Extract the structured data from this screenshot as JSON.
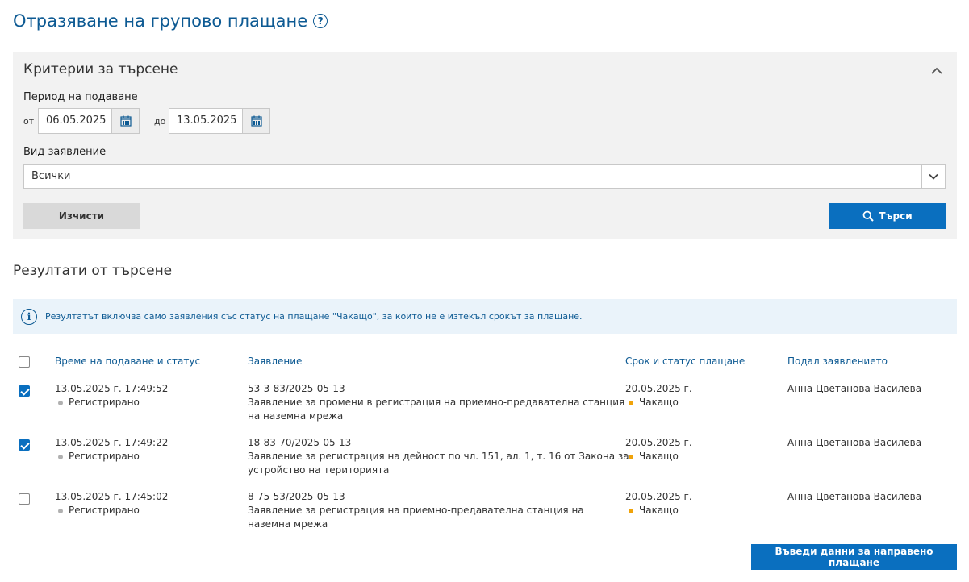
{
  "page": {
    "title": "Отразяване на групово плащане",
    "help_icon": "question-circle-icon"
  },
  "criteria": {
    "title": "Критерии за търсене",
    "period_label": "Период на подаване",
    "from_label": "от",
    "from_value": "06.05.2025",
    "to_label": "до",
    "to_value": "13.05.2025",
    "type_label": "Вид заявление",
    "type_value": "Всички",
    "clear_label": "Изчисти",
    "search_label": "Търси"
  },
  "results": {
    "title": "Резултати от търсене",
    "info_text": "Резултатът включва само заявления със статус на плащане \"Чакащо\", за които не е изтекъл срокът за плащане.",
    "headers": {
      "time": "Време на подаване и статус",
      "application": "Заявление",
      "deadline": "Срок и статус плащане",
      "submitter": "Подал заявлението"
    },
    "rows": [
      {
        "checked": true,
        "time": "13.05.2025 г. 17:49:52",
        "status": "Регистрирано",
        "number": "53-3-83/2025-05-13",
        "desc1": "Заявление за промени в регистрация на приемно-предавателна станция",
        "desc2": "на наземна мрежа",
        "deadline": "20.05.2025 г.",
        "pay_status": "Чакащо",
        "submitter": "Анна Цветанова Василева"
      },
      {
        "checked": true,
        "time": "13.05.2025 г. 17:49:22",
        "status": "Регистрирано",
        "number": "18-83-70/2025-05-13",
        "desc1": "Заявление за регистрация на дейност по чл. 151, ал. 1, т. 16 от Закона за",
        "desc2": "устройство на територията",
        "deadline": "20.05.2025 г.",
        "pay_status": "Чакащо",
        "submitter": "Анна Цветанова Василева"
      },
      {
        "checked": false,
        "time": "13.05.2025 г. 17:45:02",
        "status": "Регистрирано",
        "number": "8-75-53/2025-05-13",
        "desc1": "Заявление за регистрация на приемно-предавателна станция на",
        "desc2": "наземна мрежа",
        "deadline": "20.05.2025 г.",
        "pay_status": "Чакащо",
        "submitter": "Анна Цветанова Василева"
      }
    ],
    "enter_payment_label": "Въведи данни за направено плащане"
  },
  "colors": {
    "accent": "#0a6fbf",
    "title": "#0d5a93",
    "status_registered": "#b0b0b0",
    "status_pending": "#f0a30a"
  }
}
